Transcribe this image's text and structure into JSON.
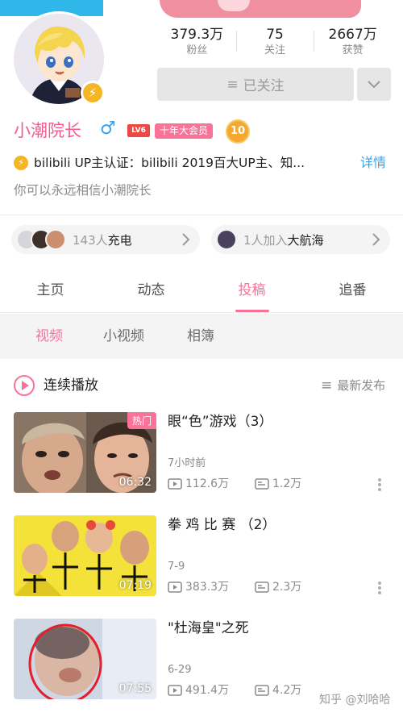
{
  "profile": {
    "name": "小潮院长",
    "gender_symbol": "♂",
    "level_badge": "LV6",
    "vip_badge": "十年大会员",
    "medal": "10",
    "stats": [
      {
        "value": "379.3万",
        "label": "粉丝"
      },
      {
        "value": "75",
        "label": "关注"
      },
      {
        "value": "2667万",
        "label": "获赞"
      }
    ],
    "follow_label": "已关注",
    "certification": "bilibili UP主认证：bilibili 2019百大UP主、知...",
    "certification_more": "详情",
    "signature": "你可以永远相信小潮院长"
  },
  "supporters": {
    "charge_count": "143人",
    "charge_label": "充电",
    "fleet_count": "1人加入",
    "fleet_label": "大航海"
  },
  "tabs": [
    {
      "label": "主页"
    },
    {
      "label": "动态"
    },
    {
      "label": "投稿"
    },
    {
      "label": "追番"
    }
  ],
  "subtabs": [
    {
      "label": "视频"
    },
    {
      "label": "小视频"
    },
    {
      "label": "相簿"
    }
  ],
  "play_all": "连续播放",
  "sort_label": "最新发布",
  "videos": [
    {
      "title": "眼“色”游戏（3）",
      "badge": "热门",
      "duration": "06:32",
      "time": "7小时前",
      "plays": "112.6万",
      "danmaku": "1.2万"
    },
    {
      "title": "拳 鸡 比 赛 （2）",
      "badge": "",
      "duration": "07:19",
      "time": "7-9",
      "plays": "383.3万",
      "danmaku": "2.3万"
    },
    {
      "title": "\"杜海皇\"之死",
      "badge": "",
      "duration": "07:55",
      "time": "6-29",
      "plays": "491.4万",
      "danmaku": "4.2万"
    }
  ],
  "watermark": "知乎 @刘哈哈",
  "colors": {
    "accent": "#fb7299",
    "link": "#36a3ef",
    "gold": "#f5b625"
  }
}
